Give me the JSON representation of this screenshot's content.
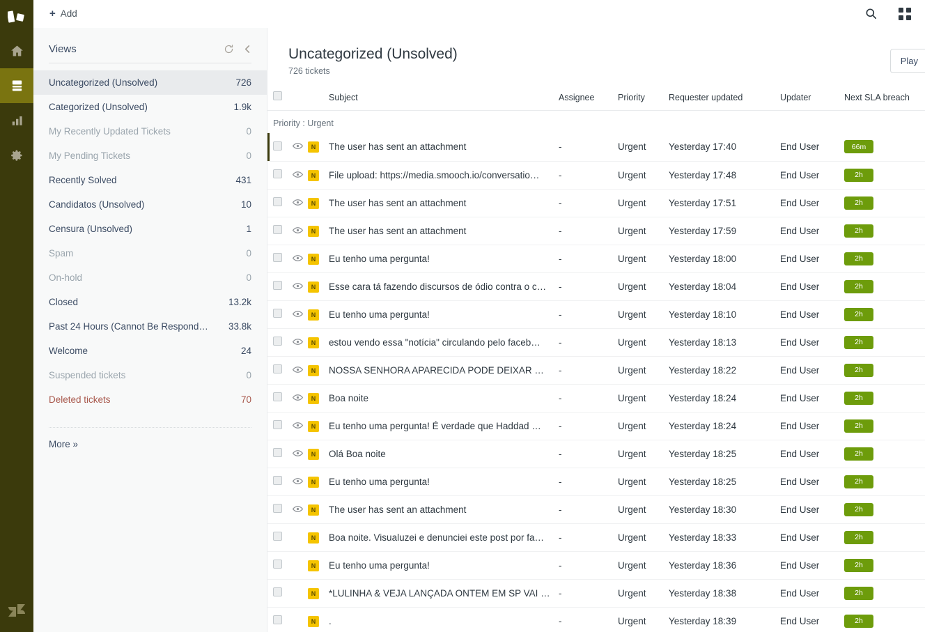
{
  "topbar": {
    "add_label": "Add",
    "search_icon": "search-icon",
    "apps_icon": "apps-grid-icon"
  },
  "rail": {
    "logo_icon": "zendesk-products-logo",
    "items": [
      {
        "icon": "home-icon",
        "name": "home",
        "active": false
      },
      {
        "icon": "tickets-icon",
        "name": "tickets",
        "active": true
      },
      {
        "icon": "reporting-bar-chart-icon",
        "name": "reporting",
        "active": false
      },
      {
        "icon": "gear-icon",
        "name": "admin",
        "active": false
      }
    ],
    "bottom_logo_icon": "zendesk-z-logo"
  },
  "sidebar": {
    "title": "Views",
    "refresh_icon": "refresh-icon",
    "collapse_icon": "chevron-left-icon",
    "more_label": "More »",
    "items": [
      {
        "label": "Uncategorized (Unsolved)",
        "count": "726",
        "state": "active"
      },
      {
        "label": "Categorized (Unsolved)",
        "count": "1.9k",
        "state": "normal"
      },
      {
        "label": "My Recently Updated Tickets",
        "count": "0",
        "state": "muted"
      },
      {
        "label": "My Pending Tickets",
        "count": "0",
        "state": "muted"
      },
      {
        "label": "Recently Solved",
        "count": "431",
        "state": "normal"
      },
      {
        "label": "Candidatos (Unsolved)",
        "count": "10",
        "state": "normal"
      },
      {
        "label": "Censura (Unsolved)",
        "count": "1",
        "state": "normal"
      },
      {
        "label": "Spam",
        "count": "0",
        "state": "muted"
      },
      {
        "label": "On-hold",
        "count": "0",
        "state": "muted"
      },
      {
        "label": "Closed",
        "count": "13.2k",
        "state": "normal"
      },
      {
        "label": "Past 24 Hours (Cannot Be Respond…",
        "count": "33.8k",
        "state": "normal"
      },
      {
        "label": "Welcome",
        "count": "24",
        "state": "normal"
      },
      {
        "label": "Suspended tickets",
        "count": "0",
        "state": "muted"
      },
      {
        "label": "Deleted tickets",
        "count": "70",
        "state": "danger"
      }
    ]
  },
  "main": {
    "title": "Uncategorized (Unsolved)",
    "subtitle": "726 tickets",
    "play_label": "Play",
    "group_label": "Priority : Urgent",
    "columns": {
      "subject": "Subject",
      "assignee": "Assignee",
      "priority": "Priority",
      "requester_updated": "Requester updated",
      "updater": "Updater",
      "next_sla_breach": "Next SLA breach"
    },
    "rows": [
      {
        "status": "N",
        "subject": "The user has sent an attachment",
        "assignee": "-",
        "priority": "Urgent",
        "requester_updated": "Yesterday 17:40",
        "updater": "End User",
        "sla": "66m",
        "eye": true,
        "accent": true
      },
      {
        "status": "N",
        "subject": "File upload: https://media.smooch.io/conversatio…",
        "assignee": "-",
        "priority": "Urgent",
        "requester_updated": "Yesterday 17:48",
        "updater": "End User",
        "sla": "2h",
        "eye": true,
        "accent": false
      },
      {
        "status": "N",
        "subject": "The user has sent an attachment",
        "assignee": "-",
        "priority": "Urgent",
        "requester_updated": "Yesterday 17:51",
        "updater": "End User",
        "sla": "2h",
        "eye": true,
        "accent": false
      },
      {
        "status": "N",
        "subject": "The user has sent an attachment",
        "assignee": "-",
        "priority": "Urgent",
        "requester_updated": "Yesterday 17:59",
        "updater": "End User",
        "sla": "2h",
        "eye": true,
        "accent": false
      },
      {
        "status": "N",
        "subject": "Eu tenho uma pergunta!",
        "assignee": "-",
        "priority": "Urgent",
        "requester_updated": "Yesterday 18:00",
        "updater": "End User",
        "sla": "2h",
        "eye": true,
        "accent": false
      },
      {
        "status": "N",
        "subject": "Esse cara tá fazendo discursos de ódio contra o c…",
        "assignee": "-",
        "priority": "Urgent",
        "requester_updated": "Yesterday 18:04",
        "updater": "End User",
        "sla": "2h",
        "eye": true,
        "accent": false
      },
      {
        "status": "N",
        "subject": "Eu tenho uma pergunta!",
        "assignee": "-",
        "priority": "Urgent",
        "requester_updated": "Yesterday 18:10",
        "updater": "End User",
        "sla": "2h",
        "eye": true,
        "accent": false
      },
      {
        "status": "N",
        "subject": "estou vendo essa \"notícia\" circulando pelo faceb…",
        "assignee": "-",
        "priority": "Urgent",
        "requester_updated": "Yesterday 18:13",
        "updater": "End User",
        "sla": "2h",
        "eye": true,
        "accent": false
      },
      {
        "status": "N",
        "subject": "NOSSA SENHORA APARECIDA PODE DEIXAR DE …",
        "assignee": "-",
        "priority": "Urgent",
        "requester_updated": "Yesterday 18:22",
        "updater": "End User",
        "sla": "2h",
        "eye": true,
        "accent": false
      },
      {
        "status": "N",
        "subject": "Boa noite",
        "assignee": "-",
        "priority": "Urgent",
        "requester_updated": "Yesterday 18:24",
        "updater": "End User",
        "sla": "2h",
        "eye": true,
        "accent": false
      },
      {
        "status": "N",
        "subject": "Eu tenho uma pergunta! É verdade que Haddad …",
        "assignee": "-",
        "priority": "Urgent",
        "requester_updated": "Yesterday 18:24",
        "updater": "End User",
        "sla": "2h",
        "eye": true,
        "accent": false
      },
      {
        "status": "N",
        "subject": "Olá Boa noite",
        "assignee": "-",
        "priority": "Urgent",
        "requester_updated": "Yesterday 18:25",
        "updater": "End User",
        "sla": "2h",
        "eye": true,
        "accent": false
      },
      {
        "status": "N",
        "subject": "Eu tenho uma pergunta!",
        "assignee": "-",
        "priority": "Urgent",
        "requester_updated": "Yesterday 18:25",
        "updater": "End User",
        "sla": "2h",
        "eye": true,
        "accent": false
      },
      {
        "status": "N",
        "subject": "The user has sent an attachment",
        "assignee": "-",
        "priority": "Urgent",
        "requester_updated": "Yesterday 18:30",
        "updater": "End User",
        "sla": "2h",
        "eye": true,
        "accent": false
      },
      {
        "status": "N",
        "subject": "Boa noite. Visualuzei e denunciei este post por fa…",
        "assignee": "-",
        "priority": "Urgent",
        "requester_updated": "Yesterday 18:33",
        "updater": "End User",
        "sla": "2h",
        "eye": false,
        "accent": false
      },
      {
        "status": "N",
        "subject": "Eu tenho uma pergunta!",
        "assignee": "-",
        "priority": "Urgent",
        "requester_updated": "Yesterday 18:36",
        "updater": "End User",
        "sla": "2h",
        "eye": false,
        "accent": false
      },
      {
        "status": "N",
        "subject": "*LULINHA & VEJA LANÇADA ONTEM EM SP VAI …",
        "assignee": "-",
        "priority": "Urgent",
        "requester_updated": "Yesterday 18:38",
        "updater": "End User",
        "sla": "2h",
        "eye": false,
        "accent": false
      },
      {
        "status": "N",
        "subject": ".",
        "assignee": "-",
        "priority": "Urgent",
        "requester_updated": "Yesterday 18:39",
        "updater": "End User",
        "sla": "2h",
        "eye": false,
        "accent": false
      }
    ]
  },
  "colors": {
    "rail_bg": "#3b3a0c",
    "rail_active": "#7a7410",
    "sla_green": "#6d9c0b",
    "badge_amber": "#f5c400",
    "text": "#2f3941"
  }
}
